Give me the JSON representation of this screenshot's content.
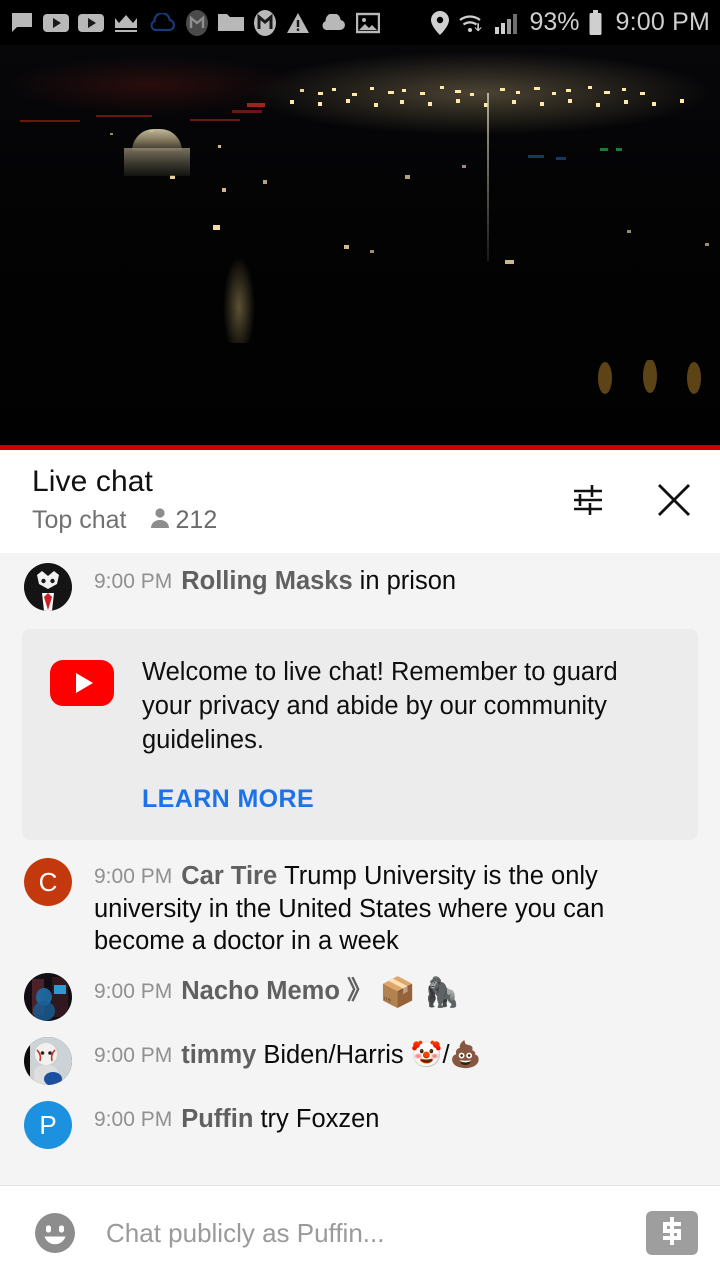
{
  "status_bar": {
    "icons": [
      "chat-bubble-icon",
      "youtube-icon",
      "youtube-icon-2",
      "crown-icon",
      "cloud-outline-icon",
      "mega-app-icon",
      "folder-icon",
      "m-badge-icon",
      "warning-triangle-icon",
      "cloud-filled-icon",
      "photo-icon",
      "location-pin-icon",
      "wifi-icon",
      "cellular-signal-icon"
    ],
    "battery_percent": "93%",
    "battery_icon": "battery-full-icon",
    "time": "9:00 PM"
  },
  "video": {
    "name": "live-stream-video",
    "description": "Night cityscape",
    "progress_color": "#cc0000"
  },
  "chat_header": {
    "title": "Live chat",
    "mode": "Top chat",
    "viewer_icon": "person-icon",
    "viewer_count": "212",
    "settings_icon": "tune-sliders-icon",
    "close_icon": "close-x-icon"
  },
  "messages": [
    {
      "id": "msg-rolling-masks",
      "timestamp": "9:00 PM",
      "author": "Rolling Masks",
      "text": "in prison",
      "avatar_type": "image",
      "avatar_name": "avatar-rolling-masks"
    },
    {
      "id": "msg-car-tire",
      "timestamp": "9:00 PM",
      "author": "Car Tire",
      "text": "Trump University is the only university in the United States where you can become a doctor in a week",
      "avatar_type": "letter",
      "avatar_letter": "C",
      "avatar_color": "#c4380d",
      "avatar_name": "avatar-car-tire"
    },
    {
      "id": "msg-nacho-memo",
      "timestamp": "9:00 PM",
      "author": "Nacho Memo 》",
      "text": "📦 🦍",
      "avatar_type": "image",
      "avatar_name": "avatar-nacho-memo"
    },
    {
      "id": "msg-timmy",
      "timestamp": "9:00 PM",
      "author": "timmy",
      "text": "Biden/Harris 🤡/💩",
      "avatar_type": "image",
      "avatar_name": "avatar-timmy"
    },
    {
      "id": "msg-puffin",
      "timestamp": "9:00 PM",
      "author": "Puffin",
      "text": "try Foxzen",
      "avatar_type": "letter",
      "avatar_letter": "P",
      "avatar_color": "#1c91e0",
      "avatar_name": "avatar-puffin"
    }
  ],
  "welcome_card": {
    "logo": "youtube-logo-icon",
    "text": "Welcome to live chat! Remember to guard your privacy and abide by our community guidelines.",
    "link_label": "LEARN MORE",
    "link_color": "#1a73e8",
    "background": "#ececec"
  },
  "input_bar": {
    "emoji_icon": "emoji-smiley-icon",
    "placeholder": "Chat publicly as Puffin...",
    "value": "",
    "superchat_icon": "dollar-sign-icon"
  }
}
